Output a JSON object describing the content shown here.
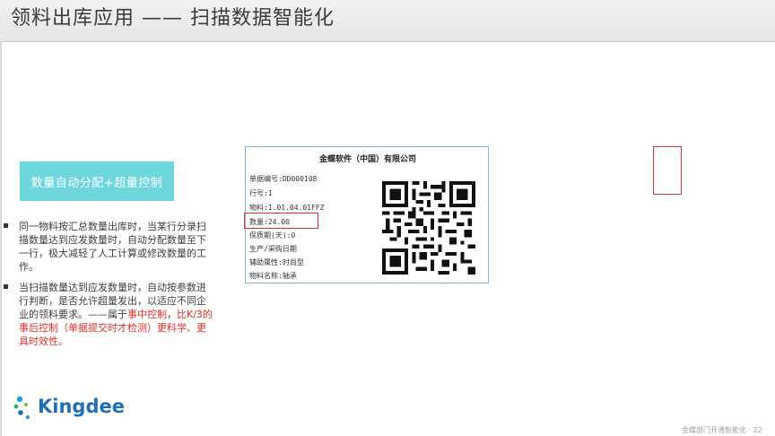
{
  "slide": {
    "title": "领料出库应用 —— 扫描数据智能化"
  },
  "feature": {
    "label": "数量自动分配+超量控制"
  },
  "bullets": {
    "b1_text": "同一物料按汇总数量出库时，当某行分录扫描数量达到应发数量时，自动分配数量至下一行，极大减轻了人工计算或修改数量的工作。",
    "b2_text_a": "当扫描数量达到应发数量时，自动按参数进行判断，是否允许超量发出，以适应不同企业的领料要求。——属于",
    "b2_red_a": "事中控制",
    "b2_text_b": "，",
    "b2_red_b": "比K/3的事后控制（单据提交时才检测）",
    "b2_red_c": "更科学、更具时效性。"
  },
  "label_card": {
    "company": "金蝶软件（中国）有限公司",
    "fields": {
      "doc_no": "单据编号:DD000108",
      "row_no": "行号:1",
      "material": "物料:1.01.04.01FFZ",
      "quantity": "数量:24.00",
      "shelf_life": "保质期(天):0",
      "prod_date": "生产/采购日期",
      "aux_attr": "辅助属性:时尚型",
      "material_name": "物料名称:轴承"
    }
  },
  "logo": {
    "text": "Kingdee"
  },
  "footer": {
    "note": "金蝶部门开通智能化 · 22"
  },
  "colors": {
    "accent_box": "#6ed6dd",
    "highlight_red": "#e0302a",
    "logo_blue": "#1f6fb5"
  }
}
